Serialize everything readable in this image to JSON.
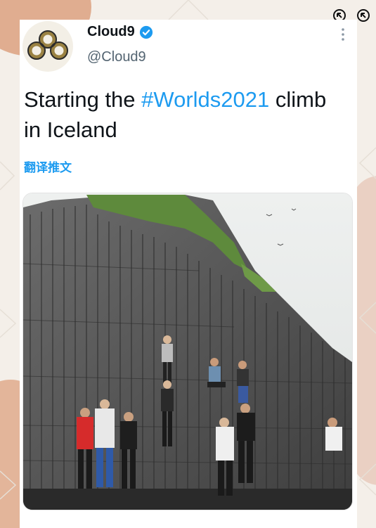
{
  "tweet": {
    "display_name": "Cloud9",
    "handle": "@Cloud9",
    "text_before": "Starting the ",
    "hashtag": "#Worlds2021",
    "text_after": " climb in Iceland",
    "translate_label": "翻译推文"
  },
  "icons": {
    "avatar": "cloud9-logo",
    "verified": "verified-badge-icon",
    "more": "more-options-icon",
    "corner_left": "arrow-up-left-circle-icon",
    "corner_right": "arrow-up-left-circle-icon"
  },
  "colors": {
    "link": "#1d9bf0",
    "text": "#0f1419",
    "secondary": "#536471",
    "background": "#f4efe9",
    "accent_blob": "#dca88d"
  }
}
